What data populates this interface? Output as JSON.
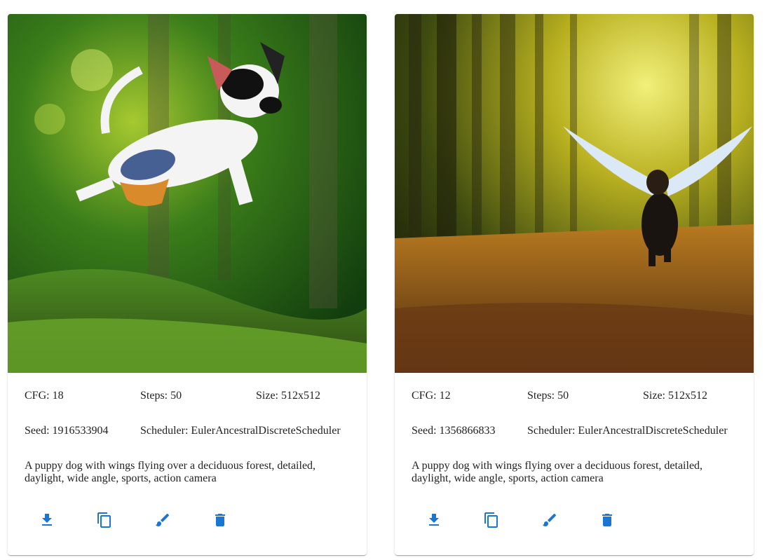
{
  "accent_color": "#1976d2",
  "cards": [
    {
      "image_alt": "Puppy jumping over forest floor",
      "cfg": "CFG: 18",
      "steps": "Steps: 50",
      "size": "Size: 512x512",
      "seed": "Seed: 1916533904",
      "scheduler": "Scheduler: EulerAncestralDiscreteScheduler",
      "prompt": "A puppy dog with wings flying over a deciduous forest, detailed, daylight, wide angle, sports, action camera",
      "actions": [
        {
          "name": "download-button",
          "icon": "download-icon"
        },
        {
          "name": "copy-button",
          "icon": "copy-icon"
        },
        {
          "name": "edit-button",
          "icon": "brush-icon"
        },
        {
          "name": "delete-button",
          "icon": "delete-icon"
        }
      ]
    },
    {
      "image_alt": "Winged dog flying in forest",
      "cfg": "CFG: 12",
      "steps": "Steps: 50",
      "size": "Size: 512x512",
      "seed": "Seed: 1356866833",
      "scheduler": "Scheduler: EulerAncestralDiscreteScheduler",
      "prompt": "A puppy dog with wings flying over a deciduous forest, detailed, daylight, wide angle, sports, action camera",
      "actions": [
        {
          "name": "download-button",
          "icon": "download-icon"
        },
        {
          "name": "copy-button",
          "icon": "copy-icon"
        },
        {
          "name": "edit-button",
          "icon": "brush-icon"
        },
        {
          "name": "delete-button",
          "icon": "delete-icon"
        }
      ]
    }
  ]
}
